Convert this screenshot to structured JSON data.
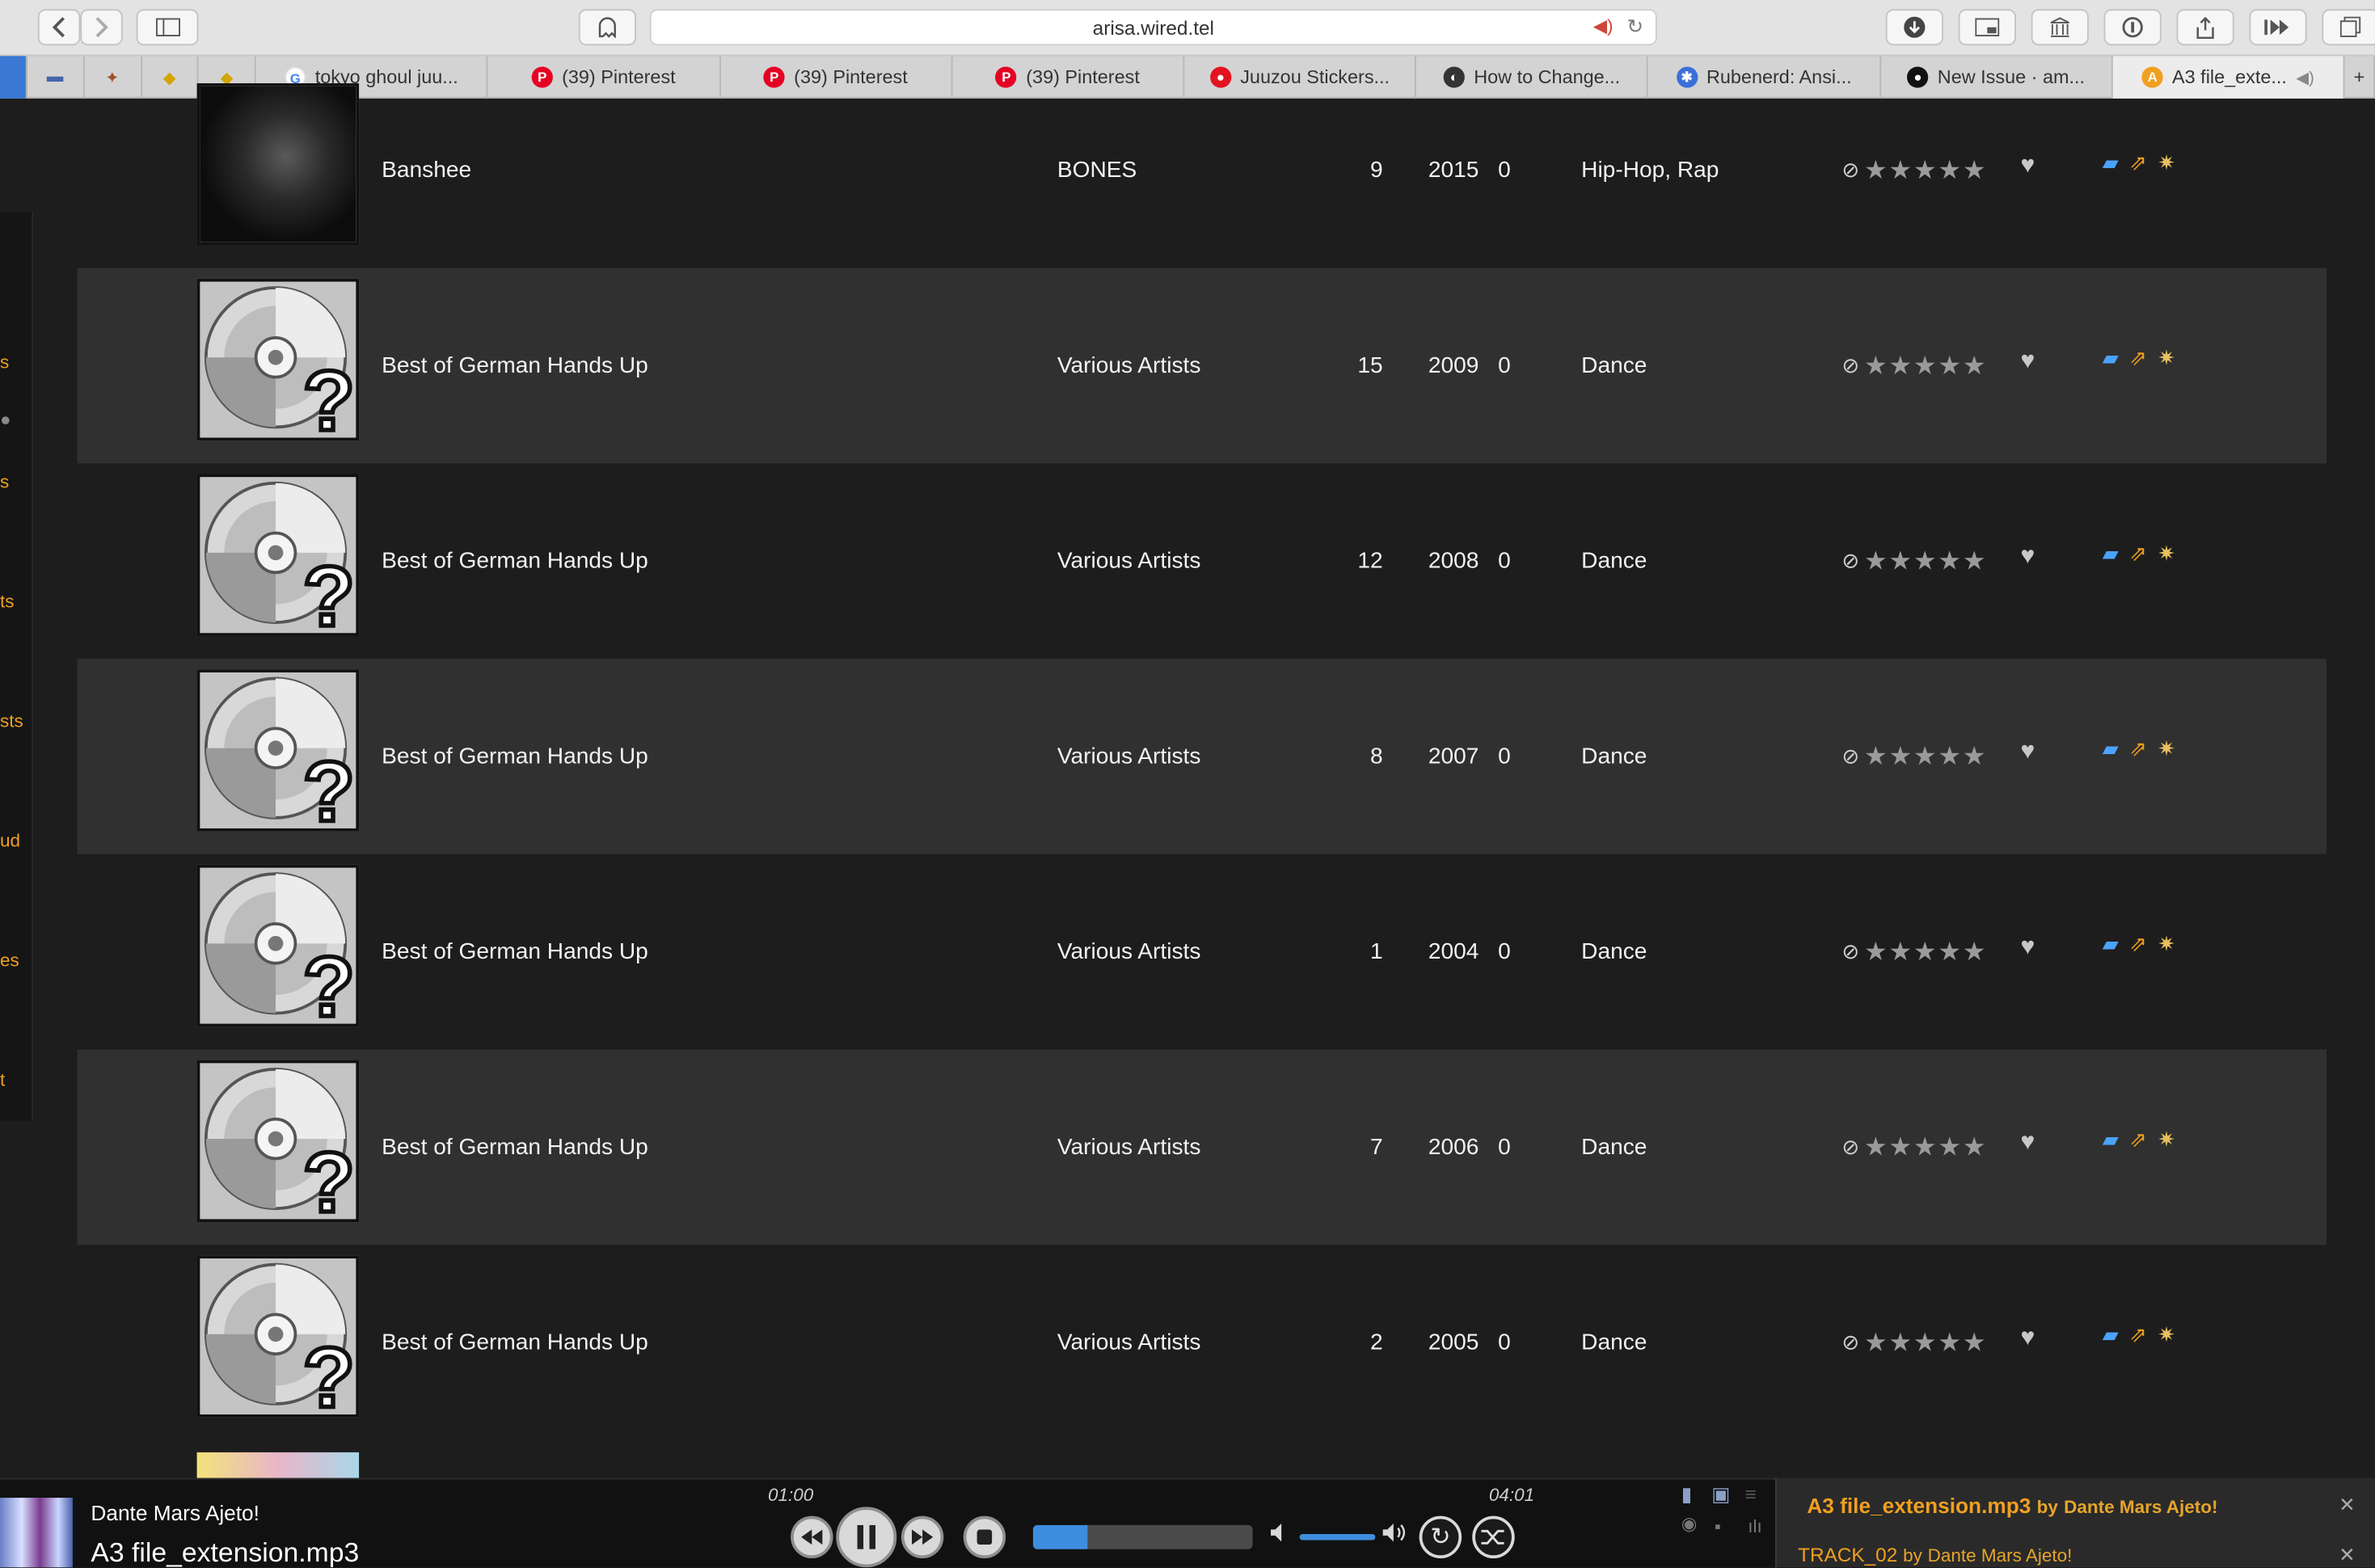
{
  "browser": {
    "url": "arisa.wired.tel",
    "tabs": [
      {
        "label": "tokyo ghoul juu...",
        "icon": "google-icon"
      },
      {
        "label": "(39) Pinterest",
        "icon": "pinterest-icon"
      },
      {
        "label": "(39) Pinterest",
        "icon": "pinterest-icon"
      },
      {
        "label": "(39) Pinterest",
        "icon": "pinterest-icon"
      },
      {
        "label": "Juuzou Stickers...",
        "icon": "redbubble-icon"
      },
      {
        "label": "How to Change...",
        "icon": "mastodon-icon"
      },
      {
        "label": "Rubenerd: Ansi...",
        "icon": "rubenerd-icon"
      },
      {
        "label": "New Issue · am...",
        "icon": "github-icon"
      },
      {
        "label": "A3 file_exte...",
        "icon": "ampache-icon"
      }
    ]
  },
  "sidebar": {
    "fragments": [
      "s",
      "s",
      "ts",
      "sts",
      "ud",
      "es",
      "t"
    ]
  },
  "rows": [
    {
      "title": "Banshee",
      "artist": "BONES",
      "track": "9",
      "year": "2015",
      "plays": "0",
      "genre": "Hip-Hop, Rap"
    },
    {
      "title": "Best of German Hands Up",
      "artist": "Various Artists",
      "track": "15",
      "year": "2009",
      "plays": "0",
      "genre": "Dance"
    },
    {
      "title": "Best of German Hands Up",
      "artist": "Various Artists",
      "track": "12",
      "year": "2008",
      "plays": "0",
      "genre": "Dance"
    },
    {
      "title": "Best of German Hands Up",
      "artist": "Various Artists",
      "track": "8",
      "year": "2007",
      "plays": "0",
      "genre": "Dance"
    },
    {
      "title": "Best of German Hands Up",
      "artist": "Various Artists",
      "track": "1",
      "year": "2004",
      "plays": "0",
      "genre": "Dance"
    },
    {
      "title": "Best of German Hands Up",
      "artist": "Various Artists",
      "track": "7",
      "year": "2006",
      "plays": "0",
      "genre": "Dance"
    },
    {
      "title": "Best of German Hands Up",
      "artist": "Various Artists",
      "track": "2",
      "year": "2005",
      "plays": "0",
      "genre": "Dance"
    }
  ],
  "player": {
    "artist": "Dante Mars Ajeto!",
    "title": "A3 file_extension.mp3",
    "elapsed": "01:00",
    "duration": "04:01",
    "progress_fraction": 0.25,
    "accent": "#3d8ede"
  },
  "queue": [
    {
      "title": "A3 file_extension.mp3",
      "by": "by",
      "artist": "Dante Mars Ajeto!"
    },
    {
      "title": "TRACK_02",
      "by": "by",
      "artist": "Dante Mars Ajeto!"
    }
  ]
}
